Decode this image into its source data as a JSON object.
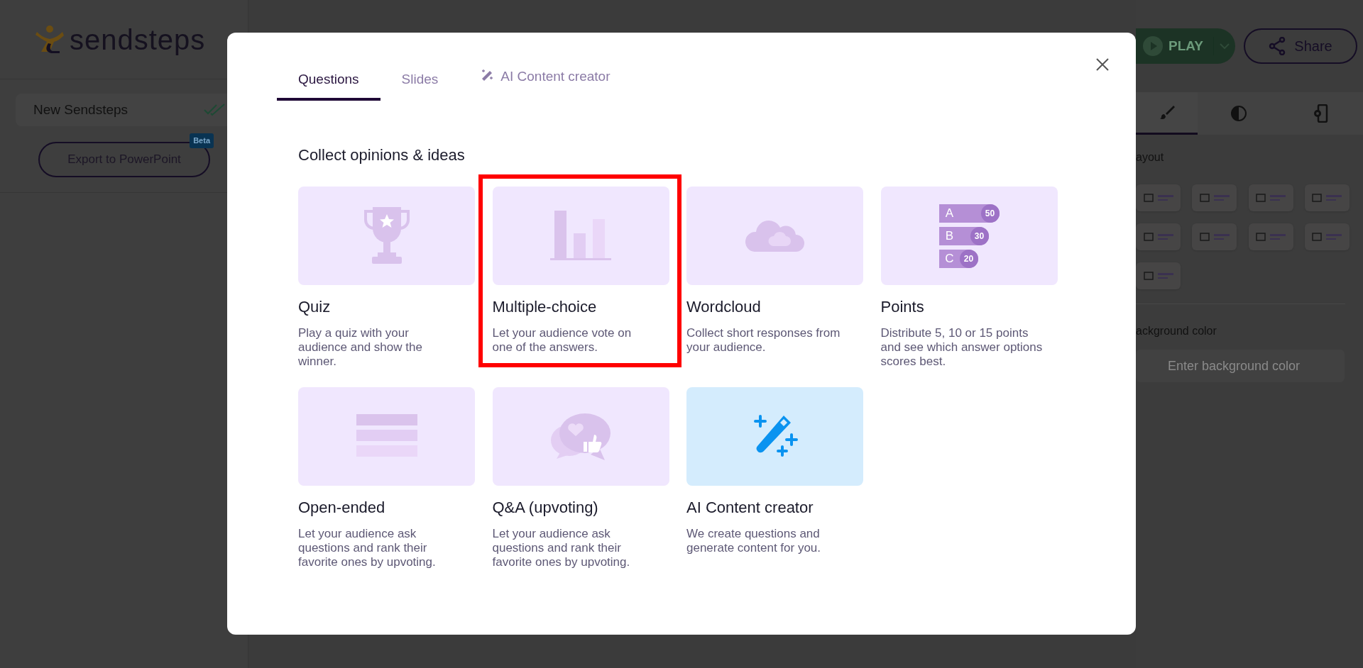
{
  "sidebar": {
    "logo": "sendsteps",
    "presentation_title": "New Sendsteps",
    "saved": true,
    "export_button": "Export to PowerPoint",
    "export_badge": "Beta"
  },
  "header": {
    "play_button": "PLAY",
    "share_button": "Share"
  },
  "right_panel": {
    "tabs": [
      {
        "kind": "brush",
        "selected": true
      },
      {
        "kind": "contrast",
        "selected": false
      },
      {
        "kind": "device-settings",
        "selected": false
      }
    ],
    "layout_label": "ayout",
    "background_label": "ackground color",
    "background_field": {
      "placeholder": "Enter background color"
    }
  },
  "modal": {
    "tabs": [
      {
        "label": "Questions",
        "selected": true,
        "kind": "plain"
      },
      {
        "label": "Slides",
        "selected": false,
        "kind": "plain"
      },
      {
        "label": "AI Content creator",
        "selected": false,
        "kind": "wand"
      }
    ],
    "section_title": "Collect opinions & ideas",
    "cards": [
      {
        "kind": "quiz",
        "title": "Quiz",
        "description": "Play a quiz with your audience and show the winner.",
        "highlighted": false
      },
      {
        "kind": "bars",
        "title": "Multiple-choice",
        "description": "Let your audience vote on one of the answers.",
        "highlighted": true
      },
      {
        "kind": "cloud",
        "title": "Wordcloud",
        "description": "Collect short responses from your audience.",
        "highlighted": false
      },
      {
        "kind": "points",
        "title": "Points",
        "description": "Distribute 5, 10 or 15 points and see which answer options scores best.",
        "highlighted": false,
        "bars": [
          {
            "letter": "A",
            "value": "50"
          },
          {
            "letter": "B",
            "value": "30"
          },
          {
            "letter": "C",
            "value": "20"
          }
        ]
      },
      {
        "kind": "open",
        "title": "Open-ended",
        "description": "Let your audience ask questions and rank their favorite ones by upvoting.",
        "highlighted": false
      },
      {
        "kind": "qa",
        "title": "Q&A (upvoting)",
        "description": "Let your audience ask questions and rank their favorite ones by upvoting.",
        "highlighted": false
      },
      {
        "kind": "ai",
        "title": "AI Content creator",
        "description": "We create questions and generate content for you.",
        "highlighted": false
      }
    ]
  }
}
